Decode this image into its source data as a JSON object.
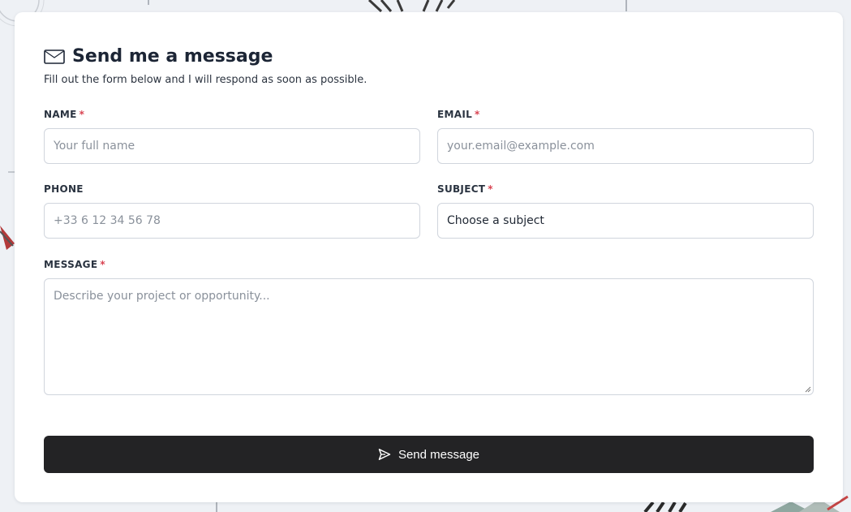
{
  "form": {
    "title": "Send me a message",
    "subtitle": "Fill out the form below and I will respond as soon as possible.",
    "required_marker": "*",
    "fields": {
      "name": {
        "label": "NAME",
        "placeholder": "Your full name",
        "required": true
      },
      "email": {
        "label": "EMAIL",
        "placeholder": "your.email@example.com",
        "required": true
      },
      "phone": {
        "label": "PHONE",
        "placeholder": "+33 6 12 34 56 78",
        "required": false
      },
      "subject": {
        "label": "SUBJECT",
        "selected": "Choose a subject",
        "required": true
      },
      "message": {
        "label": "MESSAGE",
        "placeholder": "Describe your project or opportunity...",
        "required": true
      }
    },
    "submit_label": "Send message"
  },
  "icons": {
    "title": "envelope-icon",
    "submit": "send-icon"
  },
  "colors": {
    "required": "#d94452",
    "button_bg": "#232325",
    "page_bg": "#eef1f5"
  }
}
